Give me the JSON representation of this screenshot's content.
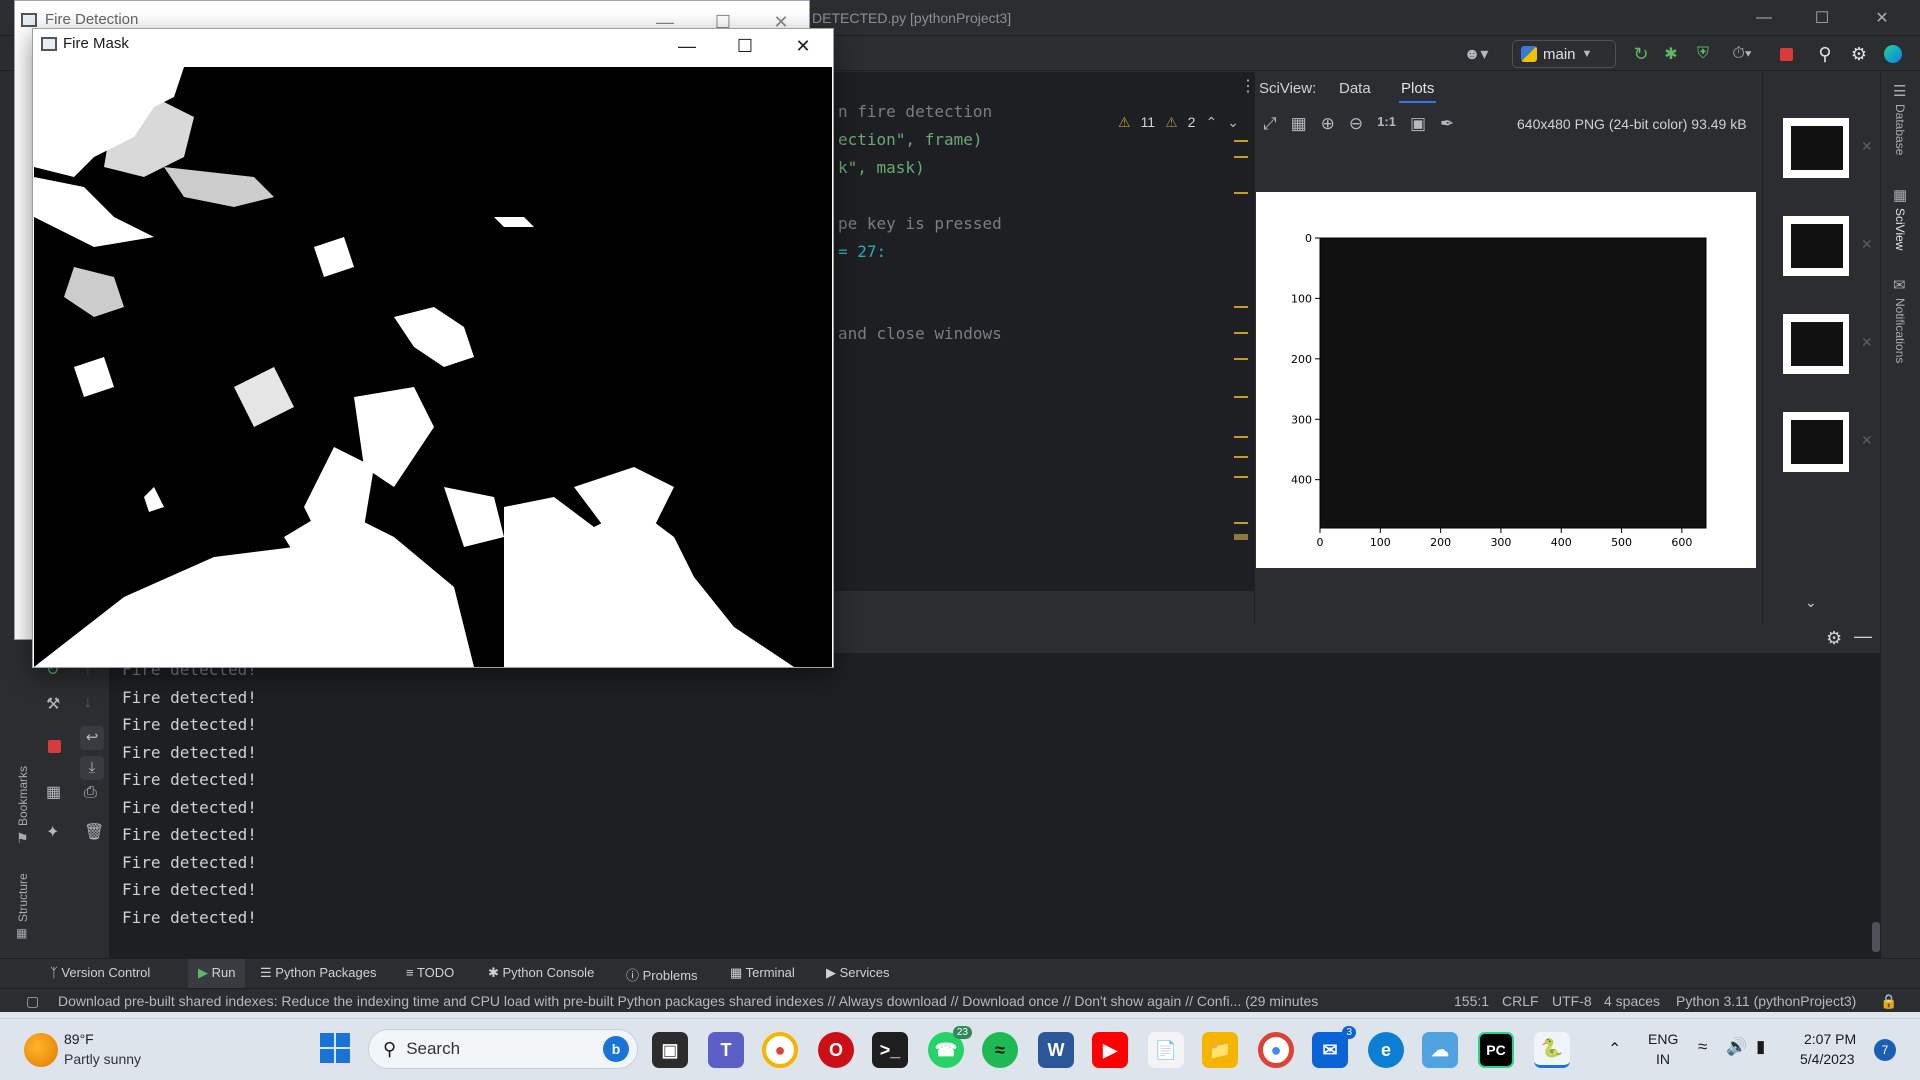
{
  "ide": {
    "title_fragment": "DETECTED.py [pythonProject3]",
    "branch": "main",
    "code_lines": [
      {
        "prefix": "",
        "text": "n fire detection"
      },
      {
        "prefix": "",
        "text": "ection\", frame)"
      },
      {
        "prefix": "",
        "text": "k\", mask)"
      },
      {
        "prefix": "",
        "text": ""
      },
      {
        "prefix": "",
        "text": "pe key is pressed"
      },
      {
        "prefix": "",
        "text": "= 27:"
      },
      {
        "prefix": "",
        "text": ""
      },
      {
        "prefix": "",
        "text": ""
      },
      {
        "prefix": "",
        "text": "and close windows"
      }
    ],
    "warnings": "11",
    "weak_warnings": "2"
  },
  "sciview": {
    "label": "SciView:",
    "tab_data": "Data",
    "tab_plots": "Plots",
    "image_info": "640x480 PNG (24-bit color) 93.49 kB",
    "zoom_actual": "1:1"
  },
  "chart_data": {
    "type": "heatmap",
    "x_ticks": [
      "0",
      "100",
      "200",
      "300",
      "400",
      "500",
      "600"
    ],
    "y_ticks": [
      "0",
      "100",
      "200",
      "300",
      "400"
    ],
    "xlim": [
      0,
      640
    ],
    "ylim": [
      480,
      0
    ],
    "fill_color": "#111111"
  },
  "right_strip": {
    "database": "Database",
    "sciview": "SciView",
    "notifications": "Notifications"
  },
  "left_strip": {
    "bookmarks": "Bookmarks",
    "structure": "Structure"
  },
  "run_output": [
    "Fire detected!",
    "Fire detected!",
    "Fire detected!",
    "Fire detected!",
    "Fire detected!",
    "Fire detected!",
    "Fire detected!",
    "Fire detected!",
    "Fire detected!",
    "Fire detected!"
  ],
  "tool_tabs": {
    "version_control": "Version Control",
    "run": "Run",
    "python_packages": "Python Packages",
    "todo": "TODO",
    "python_console": "Python Console",
    "problems": "Problems",
    "terminal": "Terminal",
    "services": "Services"
  },
  "status": {
    "message": "Download pre-built shared indexes: Reduce the indexing time and CPU load with pre-built Python packages shared indexes // Always download // Download once // Don't show again // Confi... (29 minutes",
    "position": "155:1",
    "line_sep": "CRLF",
    "encoding": "UTF-8",
    "indent": "4 spaces",
    "interpreter": "Python 3.11 (pythonProject3)"
  },
  "windows": {
    "fire_detection_title": "Fire Detection",
    "fire_mask_title": "Fire Mask"
  },
  "taskbar": {
    "temp": "89°F",
    "weather": "Partly sunny",
    "search": "Search",
    "lang": "ENG",
    "region": "IN",
    "time": "2:07 PM",
    "date": "5/4/2023",
    "notif_count": "7",
    "whatsapp_badge": "23",
    "mail_badge": "3"
  },
  "colors": {
    "ide_bg": "#2b2d30",
    "editor_bg": "#1e1f22",
    "accent_blue": "#3574f0",
    "warning": "#c59c1f",
    "stop_red": "#db3a3a"
  }
}
